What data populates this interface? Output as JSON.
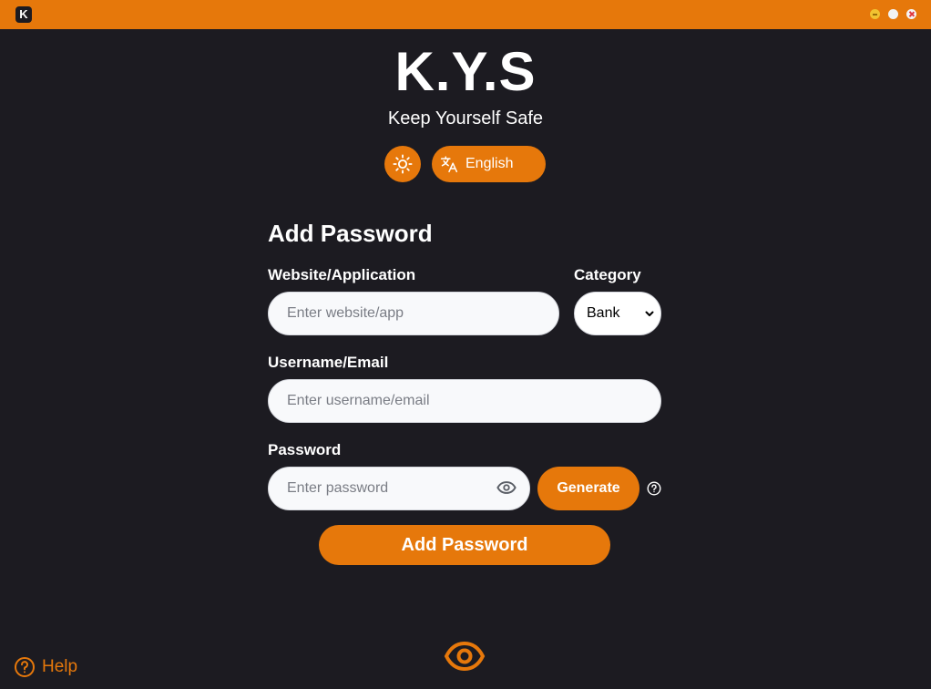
{
  "app": {
    "logo": "K.Y.S",
    "tagline": "Keep Yourself Safe",
    "icon_letter": "K"
  },
  "colors": {
    "accent": "#e6780b",
    "background": "#1c1b21",
    "input_background": "#f8f9fb"
  },
  "toolbar": {
    "theme_icon": "sun-icon",
    "language_icon": "translate-icon",
    "language_label": "English"
  },
  "form": {
    "title": "Add Password",
    "website": {
      "label": "Website/Application",
      "placeholder": "Enter website/app",
      "value": ""
    },
    "category": {
      "label": "Category",
      "selected": "Bank"
    },
    "username": {
      "label": "Username/Email",
      "placeholder": "Enter username/email",
      "value": ""
    },
    "password": {
      "label": "Password",
      "placeholder": "Enter password",
      "value": "",
      "toggle_icon": "eye-icon"
    },
    "generate_label": "Generate",
    "submit_label": "Add Password"
  },
  "footer": {
    "help_label": "Help",
    "help_icon": "question-circle-icon",
    "center_icon": "eye-icon"
  }
}
